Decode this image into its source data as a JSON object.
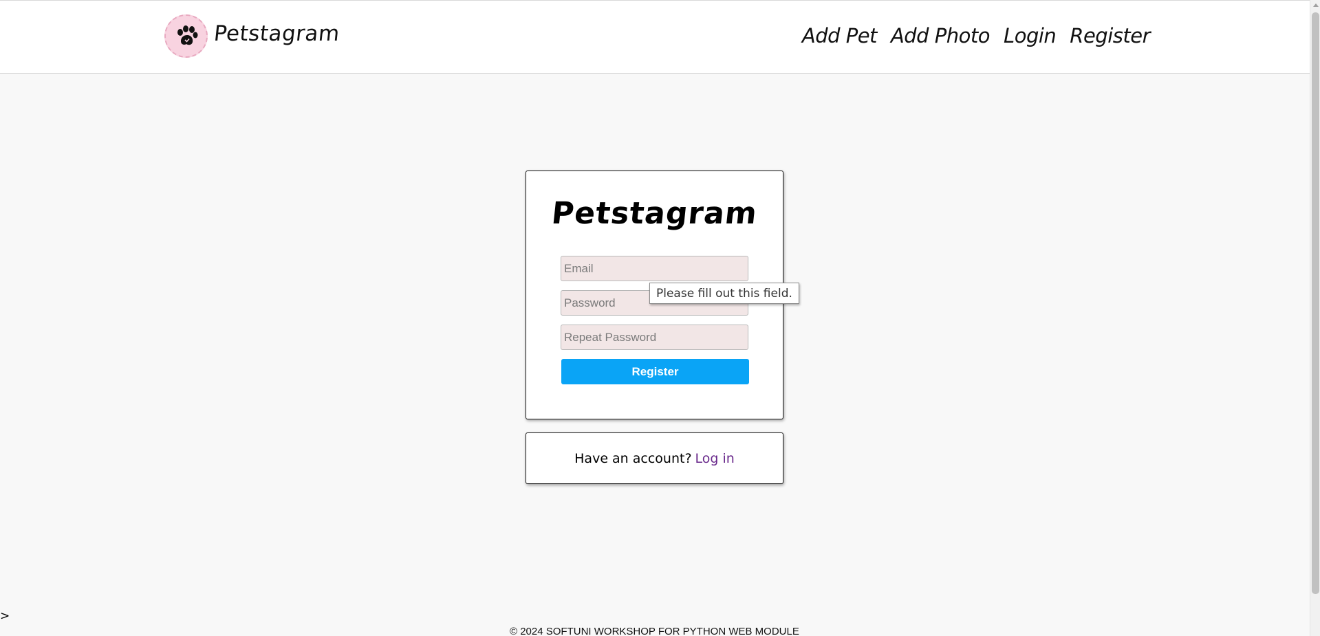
{
  "header": {
    "brand": "Petstagram",
    "nav": [
      "Add Pet",
      "Add Photo",
      "Login",
      "Register"
    ]
  },
  "register_card": {
    "title": "Petstagram",
    "email_placeholder": "Email",
    "password_placeholder": "Password",
    "repeat_password_placeholder": "Repeat Password",
    "submit_label": "Register"
  },
  "tooltip": {
    "text": "Please fill out this field."
  },
  "login_card": {
    "prompt": "Have an account?",
    "link": "Log in"
  },
  "stray_text": ">",
  "footer": {
    "copyright": "© 2024 SOFTUNI WORKSHOP FOR PYTHON WEB MODULE"
  },
  "colors": {
    "accent": "#0aa4f6",
    "link": "#6a2a8c",
    "field_bg": "#f2e6e6",
    "logo_bg": "#f8d3e0"
  },
  "icons": {
    "logo": "paw-icon"
  }
}
